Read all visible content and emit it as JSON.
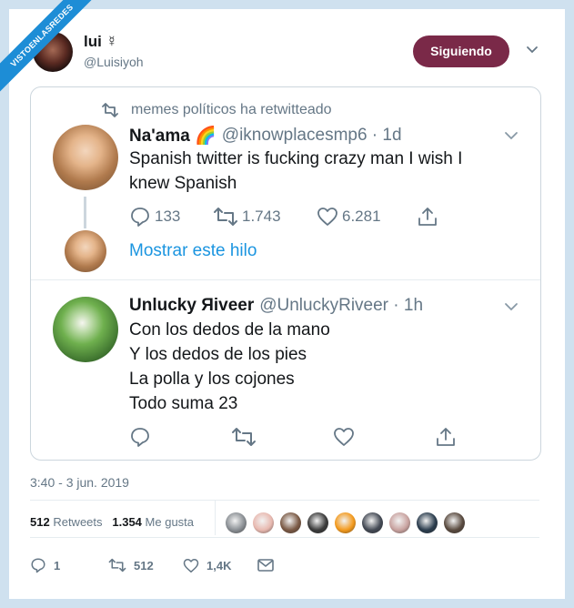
{
  "watermark": "VISTOENLASREDES",
  "author": {
    "name": "lui ☿",
    "handle": "@Luisiyoh",
    "follow_label": "Siguiendo"
  },
  "retweet_context": "memes políticos ha retwitteado",
  "quoted_tweet": {
    "name": "Na'ama 🌈",
    "handle": "@iknowplacesmp6 · 1d",
    "text_line1": "Spanish twitter is fucking crazy man I wish I",
    "text_line2": "knew Spanish",
    "replies": "133",
    "retweets": "1.743",
    "likes": "6.281",
    "show_thread": "Mostrar este hilo"
  },
  "reply_tweet": {
    "name": "Unlucky Яiveer",
    "handle": "@UnluckyRiveer · 1h",
    "lines": [
      "Con los dedos de la mano",
      "Y los dedos de los pies",
      "La polla y los cojones",
      "Todo suma 23"
    ]
  },
  "timestamp": "3:40 - 3 jun. 2019",
  "stats": {
    "retweets_count": "512",
    "retweets_label": "Retweets",
    "likes_count": "1.354",
    "likes_label": "Me gusta"
  },
  "liker_colors": [
    "#8a8f94",
    "#e8b9b0",
    "#7b5a45",
    "#3b3b3b",
    "#f39a1e",
    "#444a55",
    "#c9a3a0",
    "#2b3d4e",
    "#5a4b40"
  ],
  "footer": {
    "replies": "1",
    "retweets": "512",
    "likes": "1,4K"
  },
  "colors": {
    "accent": "#1b95e0",
    "follow_bg": "#7a2948",
    "watermark_bg": "#1d8dd6",
    "muted": "#657786"
  }
}
